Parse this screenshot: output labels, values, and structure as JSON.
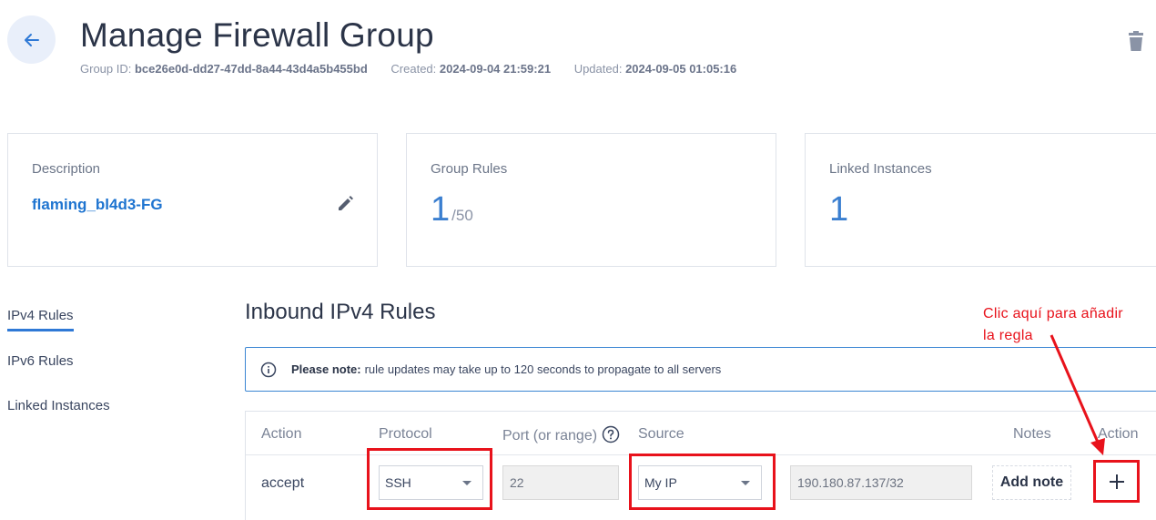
{
  "header": {
    "title": "Manage Firewall Group",
    "group_id_label": "Group ID:",
    "group_id": "bce26e0d-dd27-47dd-8a44-43d4a5b455bd",
    "created_label": "Created:",
    "created": "2024-09-04 21:59:21",
    "updated_label": "Updated:",
    "updated": "2024-09-05 01:05:16"
  },
  "cards": {
    "description_label": "Description",
    "description_value": "flaming_bl4d3-FG",
    "rules_label": "Group Rules",
    "rules_count": "1",
    "rules_max": "/50",
    "instances_label": "Linked Instances",
    "instances_count": "1"
  },
  "sidebar": {
    "items": [
      {
        "label": "IPv4 Rules",
        "active": true
      },
      {
        "label": "IPv6 Rules",
        "active": false
      },
      {
        "label": "Linked Instances",
        "active": false
      }
    ]
  },
  "main": {
    "section_title": "Inbound IPv4 Rules",
    "note_bold": "Please note:",
    "note_text": "rule updates may take up to 120 seconds to propagate to all servers",
    "columns": {
      "action": "Action",
      "protocol": "Protocol",
      "port": "Port (or range)",
      "source": "Source",
      "notes": "Notes",
      "action2": "Action"
    },
    "row": {
      "action": "accept",
      "protocol": "SSH",
      "port": "22",
      "source": "My IP",
      "ip": "190.180.87.137/32",
      "add_note": "Add note"
    }
  },
  "annotation": {
    "line1": "Clic aquí para añadir",
    "line2": "la regla"
  },
  "colors": {
    "accent": "#2f79d6",
    "annotation": "#e8121b"
  }
}
